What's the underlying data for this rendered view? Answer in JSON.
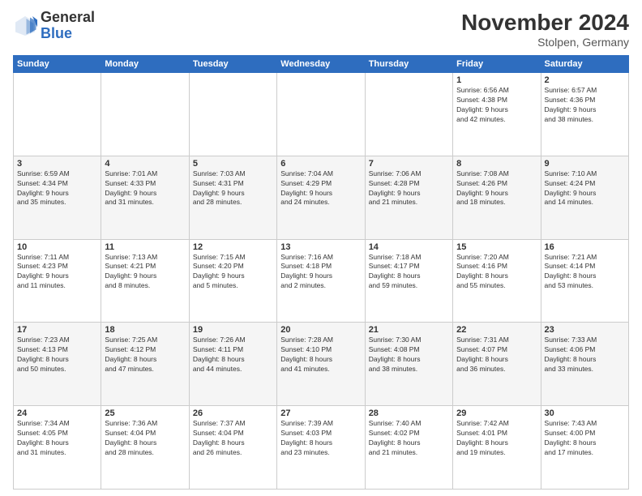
{
  "header": {
    "logo_general": "General",
    "logo_blue": "Blue",
    "month_title": "November 2024",
    "subtitle": "Stolpen, Germany"
  },
  "weekdays": [
    "Sunday",
    "Monday",
    "Tuesday",
    "Wednesday",
    "Thursday",
    "Friday",
    "Saturday"
  ],
  "weeks": [
    [
      {
        "day": "",
        "info": ""
      },
      {
        "day": "",
        "info": ""
      },
      {
        "day": "",
        "info": ""
      },
      {
        "day": "",
        "info": ""
      },
      {
        "day": "",
        "info": ""
      },
      {
        "day": "1",
        "info": "Sunrise: 6:56 AM\nSunset: 4:38 PM\nDaylight: 9 hours\nand 42 minutes."
      },
      {
        "day": "2",
        "info": "Sunrise: 6:57 AM\nSunset: 4:36 PM\nDaylight: 9 hours\nand 38 minutes."
      }
    ],
    [
      {
        "day": "3",
        "info": "Sunrise: 6:59 AM\nSunset: 4:34 PM\nDaylight: 9 hours\nand 35 minutes."
      },
      {
        "day": "4",
        "info": "Sunrise: 7:01 AM\nSunset: 4:33 PM\nDaylight: 9 hours\nand 31 minutes."
      },
      {
        "day": "5",
        "info": "Sunrise: 7:03 AM\nSunset: 4:31 PM\nDaylight: 9 hours\nand 28 minutes."
      },
      {
        "day": "6",
        "info": "Sunrise: 7:04 AM\nSunset: 4:29 PM\nDaylight: 9 hours\nand 24 minutes."
      },
      {
        "day": "7",
        "info": "Sunrise: 7:06 AM\nSunset: 4:28 PM\nDaylight: 9 hours\nand 21 minutes."
      },
      {
        "day": "8",
        "info": "Sunrise: 7:08 AM\nSunset: 4:26 PM\nDaylight: 9 hours\nand 18 minutes."
      },
      {
        "day": "9",
        "info": "Sunrise: 7:10 AM\nSunset: 4:24 PM\nDaylight: 9 hours\nand 14 minutes."
      }
    ],
    [
      {
        "day": "10",
        "info": "Sunrise: 7:11 AM\nSunset: 4:23 PM\nDaylight: 9 hours\nand 11 minutes."
      },
      {
        "day": "11",
        "info": "Sunrise: 7:13 AM\nSunset: 4:21 PM\nDaylight: 9 hours\nand 8 minutes."
      },
      {
        "day": "12",
        "info": "Sunrise: 7:15 AM\nSunset: 4:20 PM\nDaylight: 9 hours\nand 5 minutes."
      },
      {
        "day": "13",
        "info": "Sunrise: 7:16 AM\nSunset: 4:18 PM\nDaylight: 9 hours\nand 2 minutes."
      },
      {
        "day": "14",
        "info": "Sunrise: 7:18 AM\nSunset: 4:17 PM\nDaylight: 8 hours\nand 59 minutes."
      },
      {
        "day": "15",
        "info": "Sunrise: 7:20 AM\nSunset: 4:16 PM\nDaylight: 8 hours\nand 55 minutes."
      },
      {
        "day": "16",
        "info": "Sunrise: 7:21 AM\nSunset: 4:14 PM\nDaylight: 8 hours\nand 53 minutes."
      }
    ],
    [
      {
        "day": "17",
        "info": "Sunrise: 7:23 AM\nSunset: 4:13 PM\nDaylight: 8 hours\nand 50 minutes."
      },
      {
        "day": "18",
        "info": "Sunrise: 7:25 AM\nSunset: 4:12 PM\nDaylight: 8 hours\nand 47 minutes."
      },
      {
        "day": "19",
        "info": "Sunrise: 7:26 AM\nSunset: 4:11 PM\nDaylight: 8 hours\nand 44 minutes."
      },
      {
        "day": "20",
        "info": "Sunrise: 7:28 AM\nSunset: 4:10 PM\nDaylight: 8 hours\nand 41 minutes."
      },
      {
        "day": "21",
        "info": "Sunrise: 7:30 AM\nSunset: 4:08 PM\nDaylight: 8 hours\nand 38 minutes."
      },
      {
        "day": "22",
        "info": "Sunrise: 7:31 AM\nSunset: 4:07 PM\nDaylight: 8 hours\nand 36 minutes."
      },
      {
        "day": "23",
        "info": "Sunrise: 7:33 AM\nSunset: 4:06 PM\nDaylight: 8 hours\nand 33 minutes."
      }
    ],
    [
      {
        "day": "24",
        "info": "Sunrise: 7:34 AM\nSunset: 4:05 PM\nDaylight: 8 hours\nand 31 minutes."
      },
      {
        "day": "25",
        "info": "Sunrise: 7:36 AM\nSunset: 4:04 PM\nDaylight: 8 hours\nand 28 minutes."
      },
      {
        "day": "26",
        "info": "Sunrise: 7:37 AM\nSunset: 4:04 PM\nDaylight: 8 hours\nand 26 minutes."
      },
      {
        "day": "27",
        "info": "Sunrise: 7:39 AM\nSunset: 4:03 PM\nDaylight: 8 hours\nand 23 minutes."
      },
      {
        "day": "28",
        "info": "Sunrise: 7:40 AM\nSunset: 4:02 PM\nDaylight: 8 hours\nand 21 minutes."
      },
      {
        "day": "29",
        "info": "Sunrise: 7:42 AM\nSunset: 4:01 PM\nDaylight: 8 hours\nand 19 minutes."
      },
      {
        "day": "30",
        "info": "Sunrise: 7:43 AM\nSunset: 4:00 PM\nDaylight: 8 hours\nand 17 minutes."
      }
    ]
  ]
}
